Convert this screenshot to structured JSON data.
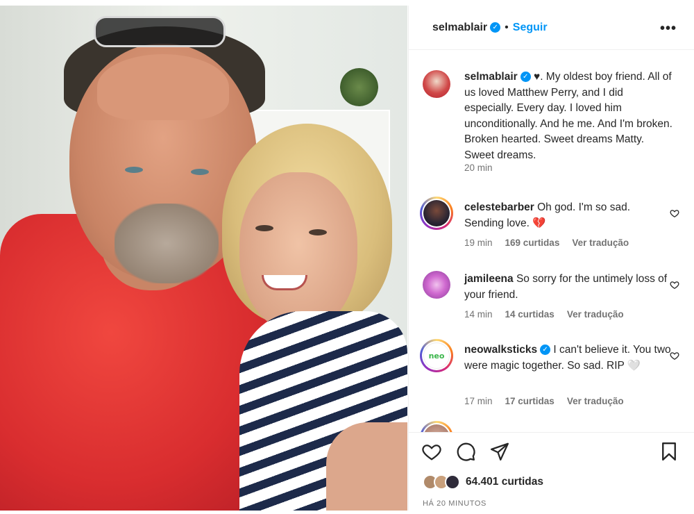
{
  "header": {
    "username": "selmablair",
    "follow_label": "Seguir",
    "separator": "•",
    "more": "•••"
  },
  "caption": {
    "username": "selmablair",
    "text": " ♥. My oldest boy friend. All of us loved Matthew Perry, and I did especially. Every day. I loved him unconditionally. And he me. And I'm broken. Broken hearted. Sweet dreams Matty. Sweet dreams.",
    "time": "20 min"
  },
  "comments": [
    {
      "username": "celestebarber",
      "text": " Oh god. I'm so sad. Sending love. 💔",
      "time": "19 min",
      "likes": "169 curtidas",
      "translate": "Ver tradução",
      "verified": false
    },
    {
      "username": "jamileena",
      "text": " So sorry for the untimely loss of your friend.",
      "time": "14 min",
      "likes": "14 curtidas",
      "translate": "Ver tradução",
      "verified": false
    },
    {
      "username": "neowalksticks",
      "text": " I can't believe it. You two were magic together. So sad. RIP 🤍",
      "time": "17 min",
      "likes": "17 curtidas",
      "translate": "Ver tradução",
      "verified": true,
      "avatar_text": "neo"
    }
  ],
  "footer": {
    "likes": "64.401 curtidas",
    "posted": "HÁ 20 MINUTOS"
  },
  "icons": {
    "verified": "verified-badge-icon",
    "like": "heart-icon",
    "comment": "comment-bubble-icon",
    "share": "paper-plane-icon",
    "save": "bookmark-icon",
    "more": "more-options-icon"
  },
  "colors": {
    "accent": "#0095f6",
    "text": "#262626",
    "muted": "#737373",
    "border": "#efefef"
  }
}
